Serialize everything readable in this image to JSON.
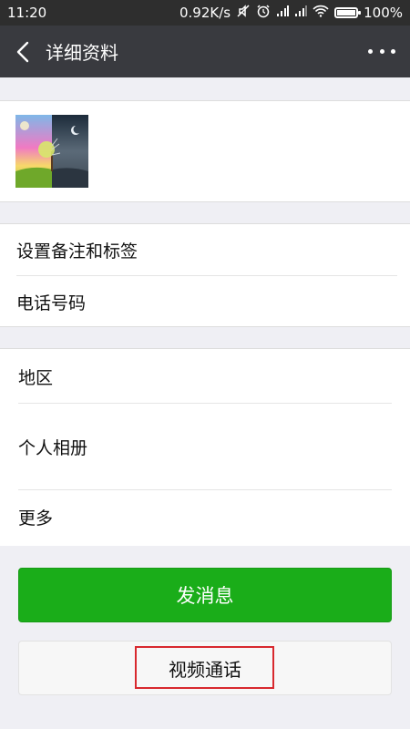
{
  "status_bar": {
    "time": "11:20",
    "network_speed": "0.92K/s",
    "battery_percent": "100%",
    "battery_level": 1.0
  },
  "header": {
    "title": "详细资料",
    "back_icon": "chevron-left-icon",
    "more_icon": "more-dots-icon"
  },
  "profile": {
    "avatar": "avatar-image"
  },
  "group1": {
    "remark_label": "设置备注和标签",
    "phone_label": "电话号码"
  },
  "group2": {
    "region_label": "地区",
    "album_label": "个人相册",
    "more_label": "更多"
  },
  "actions": {
    "send_message_label": "发消息",
    "video_call_label": "视频通话"
  },
  "colors": {
    "accent_green": "#1aad19",
    "header_bg": "#393a3f",
    "highlight_red": "#d8282e"
  }
}
